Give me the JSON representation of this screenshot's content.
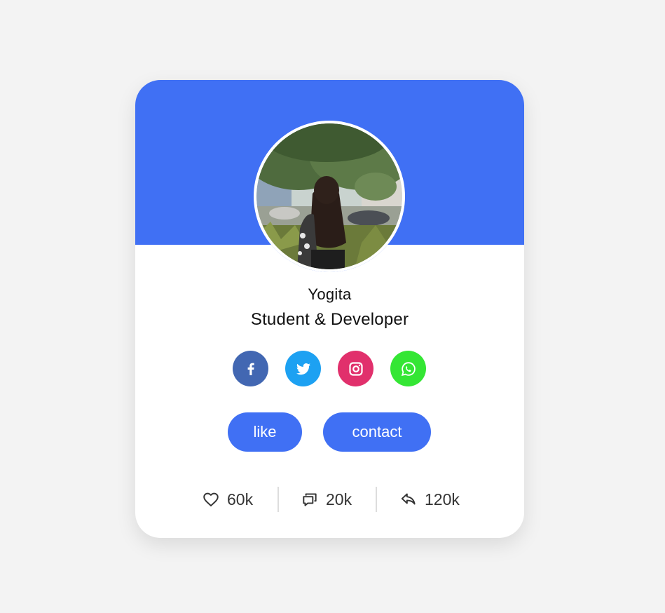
{
  "profile": {
    "name": "Yogita",
    "job": "Student & Developer"
  },
  "socials": [
    {
      "icon": "facebook-icon",
      "color": "#4267b2"
    },
    {
      "icon": "twitter-icon",
      "color": "#1da1f2"
    },
    {
      "icon": "instagram-icon",
      "color": "#e1306c"
    },
    {
      "icon": "whatsapp-icon",
      "color": "#34e634"
    }
  ],
  "buttons": {
    "like": "like",
    "contact": "contact"
  },
  "stats": {
    "likes": "60k",
    "comments": "20k",
    "shares": "120k"
  },
  "colors": {
    "accent": "#4070f4",
    "background": "#f3f3f3"
  }
}
